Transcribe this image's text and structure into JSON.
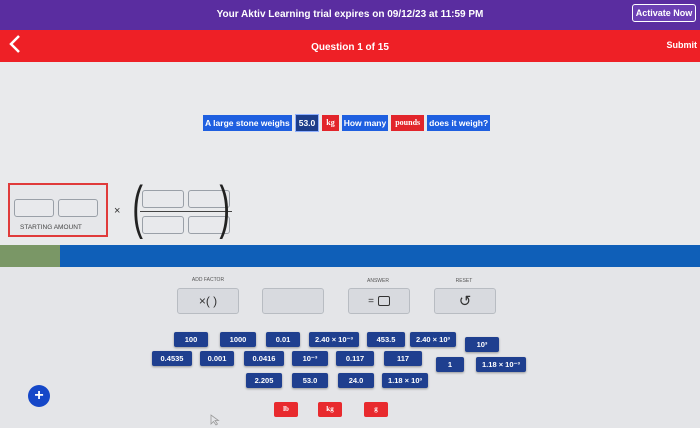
{
  "topbar": {
    "trial_text": "Your Aktiv Learning trial expires on 09/12/23 at 11:59 PM",
    "activate_label": "Activate Now"
  },
  "header": {
    "back_icon": "chevron-left-icon",
    "question_label": "Question 1 of 15",
    "submit_label": "Submit"
  },
  "question": {
    "part1": "A large stone weighs",
    "value": "53.0",
    "unit": "kg",
    "part2": "How many",
    "target_unit": "pounds",
    "part3": "does it weigh?"
  },
  "equation": {
    "starting_label": "STARTING AMOUNT",
    "times": "×",
    "lparen": "(",
    "rparen": ")"
  },
  "tools": {
    "add_factor_label": "ADD FACTOR",
    "add_factor_symbol": "×( )",
    "answer_label": "ANSWER",
    "answer_symbol": "=",
    "reset_label": "RESET",
    "reset_symbol": "↺"
  },
  "values": {
    "v100": "100",
    "v1000": "1000",
    "v001": "0.01",
    "v240e_neg": "2.40 × 10⁻³",
    "v4535": "453.5",
    "v240e_pos": "2.40 × 10³",
    "v10pos": "10³",
    "v04535": "0.4535",
    "v0001": "0.001",
    "v00416": "0.0416",
    "v10neg": "10⁻³",
    "v0117": "0.117",
    "v117": "117",
    "v1": "1",
    "v118e_neg": "1.18 × 10⁻³",
    "v2205": "2.205",
    "v530": "53.0",
    "v240": "24.0",
    "v118e_pos": "1.18 × 10³"
  },
  "units": {
    "lb": "lb",
    "kg": "kg",
    "g": "g"
  },
  "colors": {
    "trial_bar": "#5a2da0",
    "question_bar": "#ee2026",
    "value_tile": "#1f3f8f",
    "unit_tile": "#e82a2e",
    "strip_blue": "#0f5fb8",
    "strip_green": "#7a9766"
  },
  "misc": {
    "plus_symbol": "+",
    "plus_icon": "plus-icon",
    "cursor_icon": "cursor-icon"
  }
}
